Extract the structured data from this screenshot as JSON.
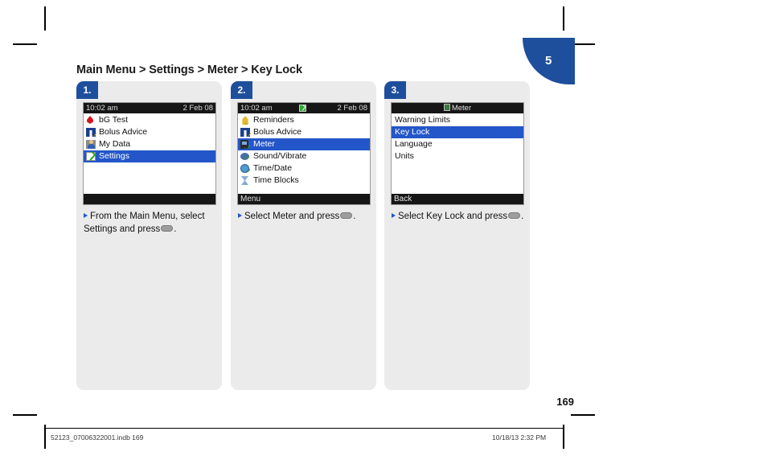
{
  "chapter_tab": {
    "number": "5"
  },
  "page_heading": "Main Menu > Settings > Meter > Key Lock",
  "page_number": "169",
  "footer": {
    "left": "52123_07006322001.indb   169",
    "right": "10/18/13   2:32 PM"
  },
  "panels": [
    {
      "step": "1.",
      "screen": {
        "type": "statusbar",
        "time": "10:02 am",
        "date": "2 Feb 08",
        "battery_icon": "battery-ok-icon",
        "show_battery": false,
        "items": [
          {
            "label": "bG Test",
            "icon": "blood-drop-icon",
            "selected": false
          },
          {
            "label": "Bolus Advice",
            "icon": "bolus-icon",
            "selected": false
          },
          {
            "label": "My Data",
            "icon": "my-data-icon",
            "selected": false
          },
          {
            "label": "Settings",
            "icon": "settings-icon",
            "selected": true
          }
        ],
        "softkey": ""
      },
      "caption": "From the Main Menu, select Settings and press",
      "caption_tail": "."
    },
    {
      "step": "2.",
      "screen": {
        "type": "statusbar",
        "time": "10:02 am",
        "date": "2 Feb 08",
        "battery_icon": "battery-ok-icon",
        "show_battery": true,
        "items": [
          {
            "label": "Reminders",
            "icon": "reminder-bell-icon",
            "selected": false
          },
          {
            "label": "Bolus Advice",
            "icon": "bolus-icon",
            "selected": false
          },
          {
            "label": "Meter",
            "icon": "meter-icon",
            "selected": true
          },
          {
            "label": "Sound/Vibrate",
            "icon": "sound-icon",
            "selected": false
          },
          {
            "label": "Time/Date",
            "icon": "clock-icon",
            "selected": false
          },
          {
            "label": "Time Blocks",
            "icon": "hourglass-icon",
            "selected": false
          }
        ],
        "softkey": "Menu"
      },
      "caption": "Select Meter and press",
      "caption_tail": "."
    },
    {
      "step": "3.",
      "screen": {
        "type": "titlebar",
        "title": "Meter",
        "title_icon": "meter-icon",
        "items": [
          {
            "label": "Warning Limits",
            "icon": "none",
            "selected": false
          },
          {
            "label": "Key Lock",
            "icon": "none",
            "selected": true
          },
          {
            "label": "Language",
            "icon": "none",
            "selected": false
          },
          {
            "label": "Units",
            "icon": "none",
            "selected": false
          }
        ],
        "softkey": "Back"
      },
      "caption": "Select Key Lock and press",
      "caption_tail": "."
    }
  ]
}
